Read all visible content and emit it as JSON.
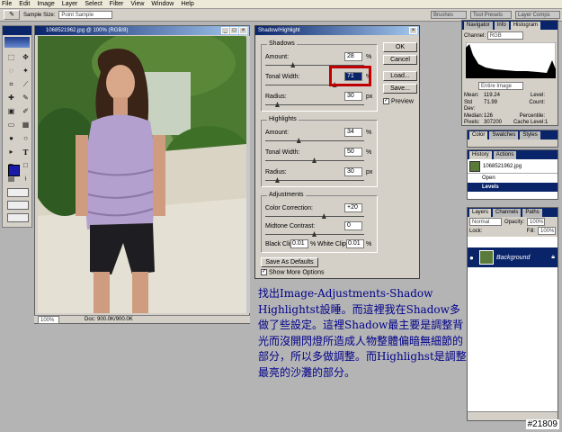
{
  "menu": [
    "File",
    "Edit",
    "Image",
    "Layer",
    "Select",
    "Filter",
    "View",
    "Window",
    "Help"
  ],
  "options_bar": {
    "sample_size_label": "Sample Size:",
    "sample_size_value": "Point Sample",
    "tabs": [
      "Brushes",
      "Tool Presets",
      "Layer Comps"
    ]
  },
  "image_window": {
    "title": "1068521962.jpg @ 100% (RGB/8)",
    "zoom": "100%",
    "doc": "Doc: 900.0K/900.0K"
  },
  "dialog": {
    "title": "Shadow/Highlight",
    "shadows": {
      "label": "Shadows",
      "amount_label": "Amount:",
      "amount": "28",
      "amount_unit": "%",
      "tonal_label": "Tonal Width:",
      "tonal": "71",
      "tonal_unit": "%",
      "radius_label": "Radius:",
      "radius": "30",
      "radius_unit": "px"
    },
    "highlights": {
      "label": "Highlights",
      "amount_label": "Amount:",
      "amount": "34",
      "amount_unit": "%",
      "tonal_label": "Tonal Width:",
      "tonal": "50",
      "tonal_unit": "%",
      "radius_label": "Radius:",
      "radius": "30",
      "radius_unit": "px"
    },
    "adjustments": {
      "label": "Adjustments",
      "color_label": "Color Correction:",
      "color": "+20",
      "midtone_label": "Midtone Contrast:",
      "midtone": "0",
      "black_label": "Black Clip:",
      "black": "0.01",
      "black_unit": "%",
      "white_label": "White Clip:",
      "white": "0.01",
      "white_unit": "%"
    },
    "buttons": {
      "ok": "OK",
      "cancel": "Cancel",
      "load": "Load...",
      "save": "Save...",
      "preview": "Preview",
      "defaults": "Save As Defaults",
      "more": "Show More Options"
    },
    "slider_levels": {
      "sh_amount": 0.28,
      "sh_tonal": 0.71,
      "sh_radius": 0.12,
      "hl_amount": 0.34,
      "hl_tonal": 0.5,
      "hl_radius": 0.12,
      "color": 0.6,
      "midtone": 0.5
    }
  },
  "navigator": {
    "tabs": [
      "Navigator",
      "Info",
      "Histogram"
    ],
    "channel_label": "Channel:",
    "channel": "RGB",
    "source": "Entire Image",
    "stats": [
      [
        "Mean:",
        "119.24",
        "Level:",
        ""
      ],
      [
        "Std Dev:",
        "71.99",
        "Count:",
        ""
      ],
      [
        "Median:",
        "126",
        "Percentile:",
        ""
      ],
      [
        "Pixels:",
        "307200",
        "Cache Level:",
        "1"
      ]
    ]
  },
  "color_panel": {
    "tabs": [
      "Color",
      "Swatches",
      "Styles"
    ]
  },
  "history_panel": {
    "tabs": [
      "History",
      "Actions"
    ],
    "snapshot": "1068521962.jpg",
    "items": [
      "Open",
      "Levels"
    ]
  },
  "layers_panel": {
    "tabs": [
      "Layers",
      "Channels",
      "Paths"
    ],
    "mode": "Normal",
    "opacity_label": "Opacity:",
    "opacity": "100%",
    "lock_label": "Lock:",
    "fill_label": "Fill:",
    "fill": "100%",
    "layer": "Background"
  },
  "caption": "找出Image-Adjustments-Shadow Highlightst設睡。而這裡我在Shadow多做了些設定。這裡Shadow最主要是調整背光而沒開閃燈所造成人物整體偏暗無細節的部分，所以多做調整。而Highlighst是調整最亮的沙灘的部分。",
  "watermark": "#21809",
  "colors": {
    "title_bar": "#0a246a",
    "highlight_box": "#c00000",
    "caption_text": "#00008b",
    "fg_swatch": "#1a1aa8"
  }
}
